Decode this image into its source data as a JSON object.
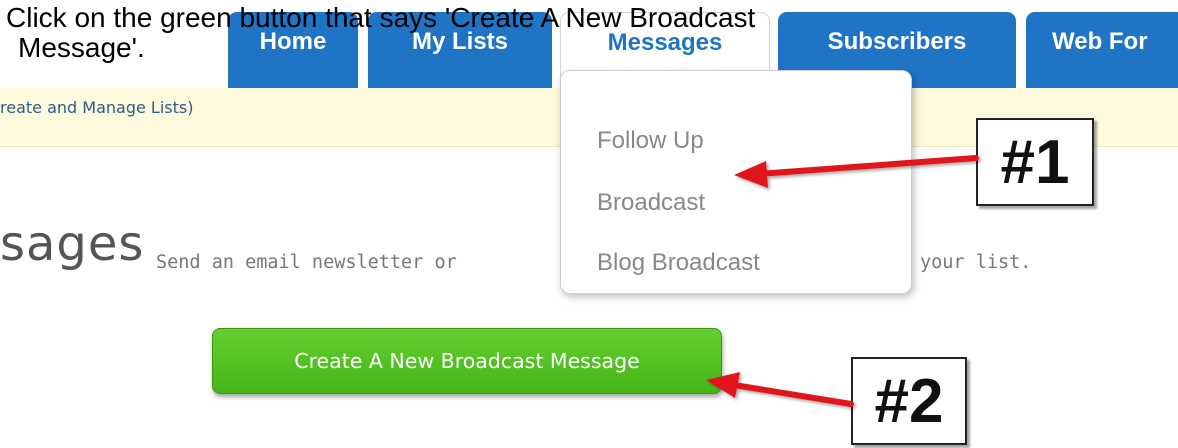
{
  "instruction": {
    "line1": "Click on the green button that says 'Create A New Broadcast",
    "line2": "Message'."
  },
  "nav": {
    "tabs": [
      {
        "label": "Home"
      },
      {
        "label": "My Lists"
      },
      {
        "label": "Messages"
      },
      {
        "label": "Subscribers"
      },
      {
        "label": "Web For"
      }
    ],
    "active_tab": "Messages"
  },
  "subheader": {
    "text": "reate and Manage Lists)"
  },
  "dropdown": {
    "items": [
      {
        "label": "Follow Up"
      },
      {
        "label": "Broadcast"
      },
      {
        "label": "Blog Broadcast"
      }
    ]
  },
  "page": {
    "heading": "sages",
    "description_left": "Send an email newsletter or",
    "description_right": "your list."
  },
  "primary_button": {
    "label": "Create A New Broadcast Message"
  },
  "callouts": [
    {
      "label": "#1"
    },
    {
      "label": "#2"
    }
  ],
  "colors": {
    "tab_blue": "#1f74c6",
    "strip_yellow": "#fcf9dd",
    "button_green": "#53c022",
    "arrow_red": "#e0161b"
  }
}
